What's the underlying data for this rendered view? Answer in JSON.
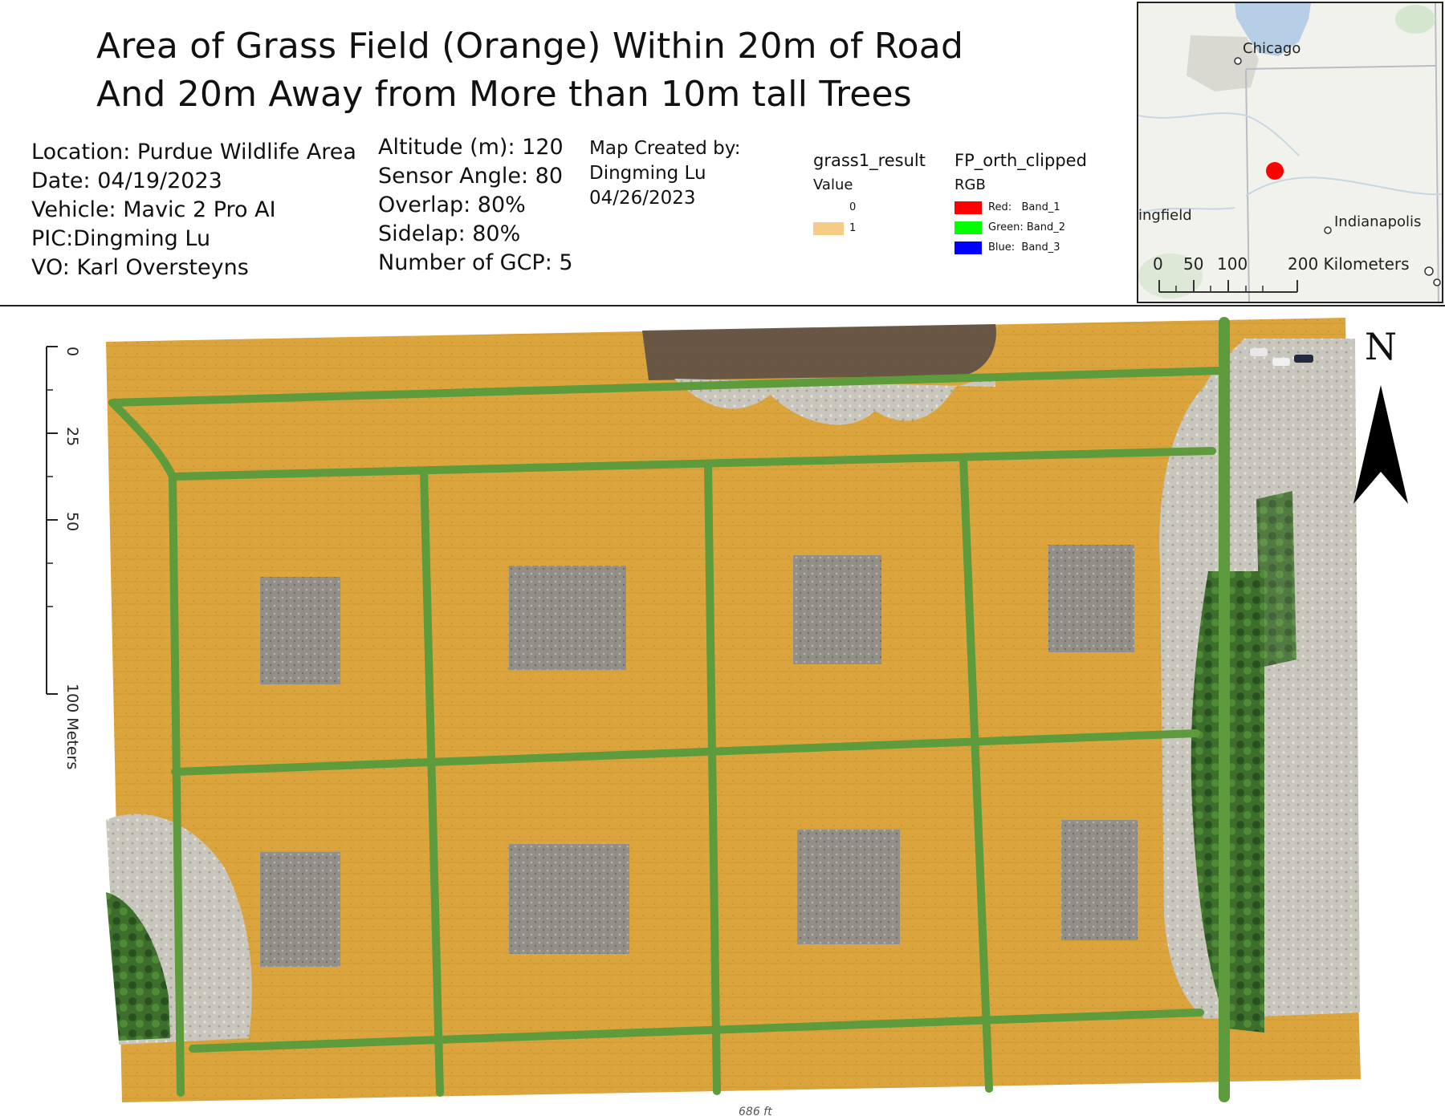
{
  "title": {
    "line1": "Area of Grass Field (Orange) Within 20m of Road",
    "line2": "And 20m Away from More than 10m tall Trees"
  },
  "flight_info": {
    "location": "Location: Purdue Wildlife Area",
    "date": "Date: 04/19/2023",
    "vehicle": "Vehicle: Mavic 2 Pro AI",
    "pic": "PIC:Dingming Lu",
    "vo": "VO: Karl Oversteyns"
  },
  "flight_params": {
    "altitude": "Altitude (m): 120",
    "sensor_angle": "Sensor Angle: 80",
    "overlap": "Overlap: 80%",
    "sidelap": "Sidelap: 80%",
    "gcp": "Number of GCP: 5"
  },
  "credits": {
    "created_by": "Map Created by:",
    "author": "Dingming Lu",
    "date": "04/26/2023"
  },
  "legend": {
    "layer1": {
      "name": "grass1_result",
      "field": "Value",
      "items": [
        {
          "label": "0",
          "color": "#ffffff"
        },
        {
          "label": "1",
          "color": "#f5cc85"
        }
      ]
    },
    "layer2": {
      "name": "FP_orth_clipped",
      "field": "RGB",
      "items": [
        {
          "label": "Red:   Band_1",
          "color": "#ff0000"
        },
        {
          "label": "Green: Band_2",
          "color": "#00ff00"
        },
        {
          "label": "Blue:  Band_3",
          "color": "#0000ff"
        }
      ]
    }
  },
  "inset": {
    "cities": [
      "Chicago",
      "ingfield",
      "Indianapolis"
    ],
    "scale_labels": [
      "0",
      "50",
      "100",
      "200 Kilometers"
    ],
    "marker_color": "#ff0000"
  },
  "main_map": {
    "north_label": "N",
    "scale_labels": [
      "0",
      "25",
      "50",
      "100 Meters"
    ],
    "footer_text": "686 ft",
    "colors": {
      "grass_orange": "#d9a53b",
      "road_green": "#5a9a3a",
      "plot_gray": "#8c8a84",
      "tree_dark": "#2f5a24"
    }
  }
}
